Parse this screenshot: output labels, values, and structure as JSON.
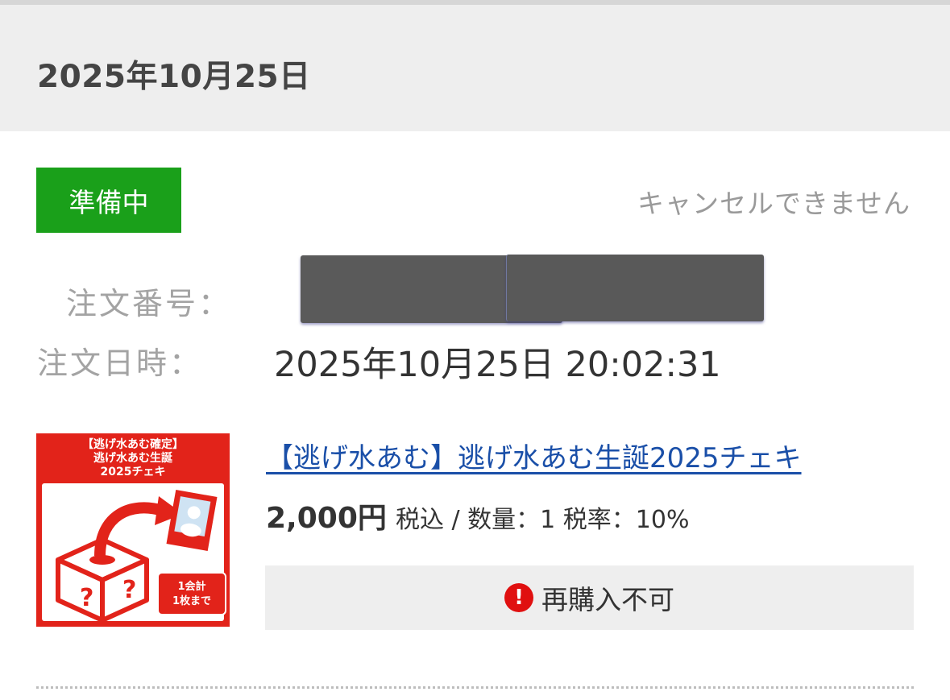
{
  "header": {
    "date": "2025年10月25日"
  },
  "order": {
    "status": "準備中",
    "cancel_note": "キャンセルできません",
    "number_label": "注文番号：",
    "datetime_label": "注文日時：",
    "datetime_value": "2025年10月25日 20:02:31"
  },
  "product": {
    "title": "【逃げ水あむ】逃げ水あむ生誕2025チェキ",
    "price": "2,000円",
    "price_meta": "税込 / 数量：1 税率：10%",
    "rebuy_label": "再購入不可",
    "thumbnail": {
      "heading_line1": "【逃げ水あむ確定】",
      "heading_line2": "逃げ水あむ生誕",
      "heading_line3": "2025チェキ",
      "limit_line1": "1会計",
      "limit_line2": "1枚まで"
    }
  },
  "colors": {
    "status_green": "#1aa01a",
    "link_blue": "#1a4fa8",
    "thumb_red": "#e2231a",
    "alert_red": "#e01010"
  }
}
